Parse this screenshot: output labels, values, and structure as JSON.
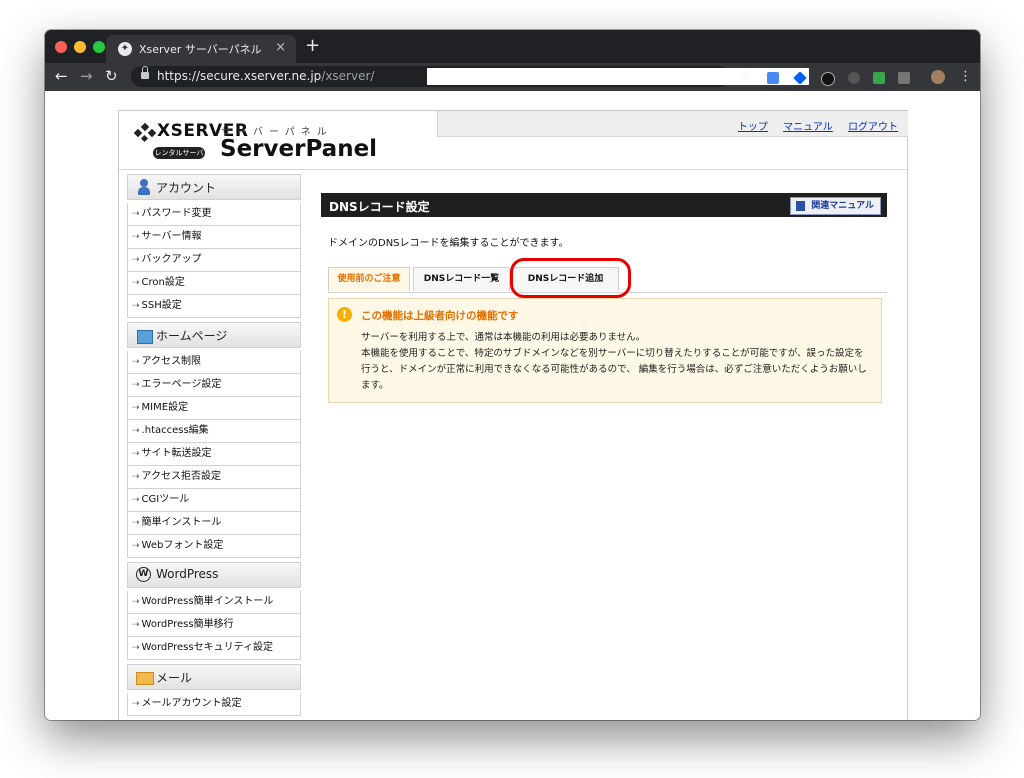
{
  "browser": {
    "tab_title": "Xserver サーバーパネル",
    "url_host": "https://secure.xserver.ne.jp",
    "url_path": "/xserver/",
    "new_tab_glyph": "+",
    "close_tab_glyph": "×"
  },
  "header": {
    "brand": "XSERVER",
    "brand_badge": "レンタルサーバー",
    "panel_kana": "サーバーパネル",
    "panel_title": "ServerPanel",
    "links": [
      "トップ",
      "マニュアル",
      "ログアウト"
    ]
  },
  "sidebar": {
    "sections": [
      {
        "title": "アカウント",
        "icon": "person-icon",
        "items": [
          "パスワード変更",
          "サーバー情報",
          "バックアップ",
          "Cron設定",
          "SSH設定"
        ]
      },
      {
        "title": "ホームページ",
        "icon": "homepage-icon",
        "items": [
          "アクセス制限",
          "エラーページ設定",
          "MIME設定",
          ".htaccess編集",
          "サイト転送設定",
          "アクセス拒否設定",
          "CGIツール",
          "簡単インストール",
          "Webフォント設定"
        ]
      },
      {
        "title": "WordPress",
        "icon": "wordpress-icon",
        "items": [
          "WordPress簡単インストール",
          "WordPress簡単移行",
          "WordPressセキュリティ設定"
        ]
      },
      {
        "title": "メール",
        "icon": "mail-icon",
        "items": [
          "メールアカウント設定"
        ]
      }
    ]
  },
  "main": {
    "title": "DNSレコード設定",
    "manual_label": "関連マニュアル",
    "description": "ドメインのDNSレコードを編集することができます。",
    "tabs": [
      "使用前のご注意",
      "DNSレコード一覧",
      "DNSレコード追加"
    ],
    "active_tab": 0,
    "highlighted_tab": 2,
    "notice": {
      "heading": "この機能は上級者向けの機能です",
      "lines": [
        "サーバーを利用する上で、通常は本機能の利用は必要ありません。",
        "本機能を使用することで、特定のサブドメインなどを別サーバーに切り替えたりすることが可能ですが、誤った設定を行うと、ドメインが正常に利用できなくなる可能性があるので、 編集を行う場合は、必ずご注意いただくようお願いします。"
      ]
    }
  },
  "colors": {
    "accent_orange": "#e07000",
    "notice_bg": "#fff8e6",
    "highlight_red": "#e60000",
    "link_blue": "#0033cc"
  }
}
